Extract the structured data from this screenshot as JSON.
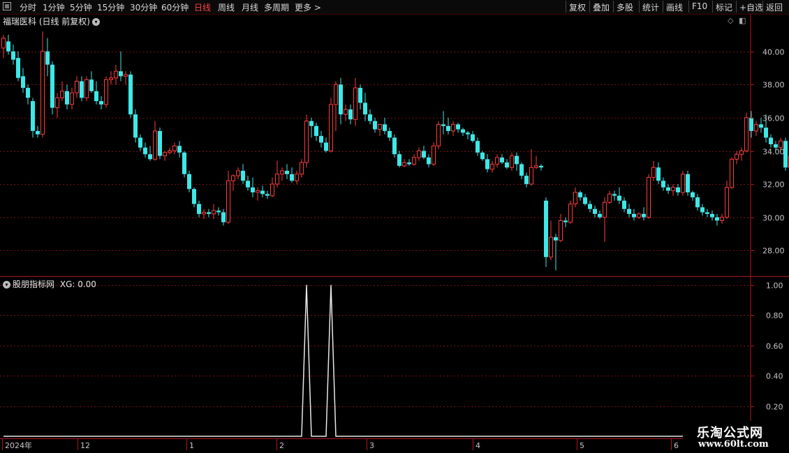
{
  "toolbar": {
    "periods": [
      {
        "label": "分时",
        "active": false
      },
      {
        "label": "1分钟",
        "active": false
      },
      {
        "label": "5分钟",
        "active": false
      },
      {
        "label": "15分钟",
        "active": false
      },
      {
        "label": "30分钟",
        "active": false
      },
      {
        "label": "60分钟",
        "active": false
      },
      {
        "label": "日线",
        "active": true
      },
      {
        "label": "周线",
        "active": false
      },
      {
        "label": "月线",
        "active": false
      },
      {
        "label": "多周期",
        "active": false
      },
      {
        "label": "更多 >",
        "active": false
      }
    ],
    "buttons": [
      "复权",
      "叠加",
      "多股",
      "统计",
      "画线",
      "F10",
      "标记",
      "+自选",
      "返回"
    ]
  },
  "main_pane": {
    "title": "福瑞医科 (日线 前复权)",
    "y_ticks": [
      "40.00",
      "38.00",
      "36.00",
      "34.00",
      "32.00",
      "30.00",
      "28.00"
    ]
  },
  "indicator_pane": {
    "title": "股朋指标网",
    "value_text": "XG: 0.00",
    "y_ticks": [
      "1.00",
      "0.80",
      "0.60",
      "0.40",
      "0.20"
    ]
  },
  "x_axis": {
    "labels": [
      "2024年",
      "12",
      "1",
      "2",
      "3",
      "4",
      "5",
      "6"
    ]
  },
  "watermark": {
    "title": "乐淘公式网",
    "url": "www.60lt.com"
  },
  "colors": {
    "up": "#ff3c3c",
    "down": "#3ee8e8",
    "grid": "#7a1010",
    "axis": "#b01818",
    "active_period": "#ff4040"
  },
  "chart_data": [
    {
      "type": "candlestick",
      "ylim": [
        26.5,
        41.5
      ],
      "ohlc": [
        [
          40.2,
          41.0,
          39.6,
          40.8
        ],
        [
          40.6,
          41.0,
          39.8,
          40.0
        ],
        [
          40.0,
          40.4,
          39.2,
          39.5
        ],
        [
          39.6,
          40.0,
          38.2,
          38.4
        ],
        [
          38.5,
          39.0,
          37.5,
          37.8
        ],
        [
          37.8,
          38.0,
          36.8,
          37.2
        ],
        [
          37.0,
          37.2,
          34.8,
          35.2
        ],
        [
          35.2,
          35.5,
          34.8,
          35.0
        ],
        [
          35.0,
          41.2,
          34.8,
          40.0
        ],
        [
          40.0,
          40.8,
          38.5,
          39.2
        ],
        [
          39.2,
          39.4,
          36.2,
          36.6
        ],
        [
          36.6,
          37.5,
          36.0,
          37.2
        ],
        [
          37.2,
          38.2,
          37.0,
          37.6
        ],
        [
          37.6,
          38.0,
          36.5,
          36.8
        ],
        [
          36.8,
          37.8,
          36.5,
          37.5
        ],
        [
          37.5,
          38.5,
          37.2,
          38.2
        ],
        [
          38.2,
          38.5,
          37.0,
          37.2
        ],
        [
          37.2,
          38.5,
          37.0,
          38.3
        ],
        [
          38.3,
          38.8,
          37.5,
          37.6
        ],
        [
          37.6,
          38.2,
          36.8,
          37.0
        ],
        [
          37.0,
          37.3,
          36.5,
          36.8
        ],
        [
          36.8,
          38.5,
          36.6,
          38.3
        ],
        [
          38.3,
          38.8,
          38.0,
          38.4
        ],
        [
          38.4,
          39.2,
          38.0,
          38.8
        ],
        [
          38.8,
          40.0,
          38.2,
          38.5
        ],
        [
          38.5,
          38.8,
          38.0,
          38.6
        ],
        [
          38.6,
          38.8,
          36.0,
          36.2
        ],
        [
          36.2,
          36.5,
          34.5,
          34.8
        ],
        [
          34.8,
          35.0,
          34.0,
          34.2
        ],
        [
          34.2,
          34.5,
          33.6,
          33.8
        ],
        [
          33.8,
          34.3,
          33.4,
          33.5
        ],
        [
          33.5,
          35.8,
          33.4,
          35.2
        ],
        [
          35.2,
          35.4,
          33.5,
          33.7
        ],
        [
          33.7,
          34.0,
          33.4,
          33.9
        ],
        [
          33.9,
          34.2,
          33.8,
          34.0
        ],
        [
          34.0,
          34.5,
          33.8,
          34.3
        ],
        [
          34.3,
          34.6,
          33.6,
          33.9
        ],
        [
          33.9,
          34.0,
          32.4,
          32.6
        ],
        [
          32.6,
          32.8,
          31.5,
          31.7
        ],
        [
          31.7,
          31.8,
          30.6,
          30.8
        ],
        [
          30.8,
          31.0,
          30.0,
          30.2
        ],
        [
          30.2,
          30.5,
          29.9,
          30.3
        ],
        [
          30.3,
          30.5,
          30.0,
          30.2
        ],
        [
          30.2,
          30.8,
          29.9,
          30.4
        ],
        [
          30.4,
          30.6,
          30.1,
          30.3
        ],
        [
          30.3,
          30.5,
          29.5,
          29.7
        ],
        [
          29.7,
          32.8,
          29.6,
          32.2
        ],
        [
          32.2,
          32.6,
          31.6,
          32.5
        ],
        [
          32.5,
          33.0,
          32.3,
          32.8
        ],
        [
          32.8,
          33.2,
          32.0,
          32.2
        ],
        [
          32.2,
          32.5,
          31.6,
          31.8
        ],
        [
          31.8,
          32.4,
          31.2,
          31.5
        ],
        [
          31.5,
          31.8,
          31.0,
          31.6
        ],
        [
          31.6,
          31.9,
          31.2,
          31.4
        ],
        [
          31.4,
          31.6,
          31.1,
          31.3
        ],
        [
          31.3,
          32.4,
          31.2,
          32.0
        ],
        [
          32.0,
          33.4,
          31.8,
          32.6
        ],
        [
          32.6,
          33.0,
          32.2,
          32.8
        ],
        [
          32.8,
          33.2,
          32.3,
          32.6
        ],
        [
          32.6,
          33.0,
          32.1,
          32.2
        ],
        [
          32.2,
          32.8,
          32.0,
          32.6
        ],
        [
          32.6,
          33.5,
          32.4,
          33.3
        ],
        [
          33.3,
          36.2,
          33.0,
          35.8
        ],
        [
          35.8,
          36.0,
          34.8,
          35.5
        ],
        [
          35.5,
          35.7,
          34.6,
          34.9
        ],
        [
          34.9,
          35.2,
          34.2,
          34.5
        ],
        [
          34.5,
          34.8,
          33.9,
          34.0
        ],
        [
          34.0,
          37.2,
          33.9,
          36.8
        ],
        [
          36.8,
          38.2,
          35.2,
          38.0
        ],
        [
          38.0,
          38.4,
          35.6,
          36.2
        ],
        [
          36.2,
          36.8,
          35.8,
          36.5
        ],
        [
          36.5,
          36.8,
          35.6,
          35.9
        ],
        [
          35.9,
          38.4,
          35.5,
          37.8
        ],
        [
          37.8,
          38.0,
          36.5,
          36.9
        ],
        [
          36.9,
          37.5,
          35.8,
          36.2
        ],
        [
          36.2,
          36.5,
          35.6,
          35.8
        ],
        [
          35.8,
          36.0,
          35.1,
          35.3
        ],
        [
          35.3,
          35.6,
          34.9,
          35.6
        ],
        [
          35.6,
          36.0,
          35.0,
          35.2
        ],
        [
          35.2,
          35.4,
          34.6,
          34.8
        ],
        [
          34.8,
          35.0,
          33.6,
          33.8
        ],
        [
          33.8,
          34.0,
          33.0,
          33.1
        ],
        [
          33.1,
          33.5,
          33.0,
          33.3
        ],
        [
          33.3,
          33.5,
          33.1,
          33.2
        ],
        [
          33.2,
          33.8,
          33.1,
          33.6
        ],
        [
          33.6,
          34.2,
          33.4,
          34.0
        ],
        [
          34.0,
          34.3,
          33.5,
          33.6
        ],
        [
          33.6,
          33.8,
          33.0,
          33.2
        ],
        [
          33.2,
          34.5,
          33.1,
          34.3
        ],
        [
          34.3,
          35.8,
          34.1,
          35.6
        ],
        [
          35.6,
          36.4,
          35.0,
          35.5
        ],
        [
          35.5,
          36.0,
          35.0,
          35.2
        ],
        [
          35.2,
          35.8,
          34.9,
          35.6
        ],
        [
          35.6,
          35.7,
          35.1,
          35.3
        ],
        [
          35.3,
          35.4,
          34.9,
          35.1
        ],
        [
          35.1,
          35.2,
          34.7,
          35.0
        ],
        [
          35.0,
          35.2,
          34.5,
          34.6
        ],
        [
          34.6,
          34.8,
          33.7,
          33.9
        ],
        [
          33.9,
          34.0,
          33.4,
          33.5
        ],
        [
          33.5,
          33.8,
          32.7,
          32.9
        ],
        [
          32.9,
          33.4,
          32.7,
          33.2
        ],
        [
          33.2,
          33.8,
          33.0,
          33.6
        ],
        [
          33.6,
          33.8,
          33.2,
          33.3
        ],
        [
          33.3,
          33.5,
          32.9,
          33.0
        ],
        [
          33.0,
          33.9,
          32.8,
          33.7
        ],
        [
          33.7,
          33.9,
          32.8,
          33.2
        ],
        [
          33.2,
          33.3,
          32.3,
          32.5
        ],
        [
          32.5,
          32.7,
          31.8,
          32.0
        ],
        [
          32.0,
          34.1,
          31.9,
          33.0
        ],
        [
          33.0,
          33.7,
          32.9,
          33.1
        ],
        [
          33.1,
          33.2,
          32.8,
          33.0
        ],
        [
          31.0,
          31.2,
          27.0,
          27.6
        ],
        [
          27.6,
          29.8,
          27.4,
          28.8
        ],
        [
          28.8,
          29.0,
          26.8,
          28.6
        ],
        [
          28.6,
          30.2,
          28.5,
          29.8
        ],
        [
          29.8,
          30.0,
          29.4,
          29.7
        ],
        [
          29.7,
          31.0,
          29.6,
          30.8
        ],
        [
          30.8,
          31.8,
          30.6,
          31.5
        ],
        [
          31.5,
          31.6,
          31.0,
          31.2
        ],
        [
          31.2,
          31.4,
          30.7,
          30.8
        ],
        [
          30.8,
          31.0,
          30.3,
          30.5
        ],
        [
          30.5,
          30.7,
          30.0,
          30.2
        ],
        [
          30.2,
          30.4,
          29.9,
          30.0
        ],
        [
          30.0,
          31.2,
          28.5,
          30.9
        ],
        [
          30.9,
          31.6,
          30.8,
          31.4
        ],
        [
          31.4,
          31.6,
          31.0,
          31.3
        ],
        [
          31.3,
          31.8,
          30.8,
          31.0
        ],
        [
          31.0,
          31.2,
          30.3,
          30.5
        ],
        [
          30.5,
          30.8,
          30.0,
          30.2
        ],
        [
          30.2,
          30.5,
          29.8,
          30.0
        ],
        [
          30.0,
          30.3,
          29.9,
          30.2
        ],
        [
          30.2,
          30.6,
          29.8,
          30.0
        ],
        [
          30.0,
          32.6,
          29.9,
          32.4
        ],
        [
          32.4,
          33.4,
          32.2,
          33.0
        ],
        [
          33.0,
          33.3,
          32.0,
          32.2
        ],
        [
          32.2,
          32.4,
          31.6,
          31.8
        ],
        [
          31.8,
          32.0,
          31.4,
          31.6
        ],
        [
          31.6,
          32.0,
          31.3,
          31.8
        ],
        [
          31.8,
          32.0,
          31.3,
          31.5
        ],
        [
          31.5,
          32.8,
          31.3,
          32.6
        ],
        [
          32.6,
          32.8,
          31.3,
          31.5
        ],
        [
          31.5,
          31.6,
          31.0,
          31.2
        ],
        [
          31.2,
          31.4,
          30.4,
          30.6
        ],
        [
          30.6,
          30.8,
          30.1,
          30.3
        ],
        [
          30.3,
          30.5,
          30.0,
          30.2
        ],
        [
          30.2,
          30.4,
          29.8,
          30.0
        ],
        [
          30.0,
          30.2,
          29.5,
          29.8
        ],
        [
          29.8,
          30.2,
          29.6,
          30.0
        ],
        [
          30.0,
          32.2,
          29.9,
          31.8
        ],
        [
          31.8,
          33.6,
          31.7,
          33.5
        ],
        [
          33.5,
          34.0,
          33.2,
          33.8
        ],
        [
          33.8,
          34.2,
          33.4,
          34.0
        ],
        [
          34.0,
          36.3,
          33.9,
          36.0
        ],
        [
          36.0,
          36.4,
          34.8,
          35.2
        ],
        [
          35.2,
          35.8,
          34.9,
          35.6
        ],
        [
          35.6,
          36.0,
          35.1,
          35.4
        ],
        [
          35.4,
          36.2,
          34.5,
          34.8
        ],
        [
          34.8,
          35.0,
          34.2,
          34.4
        ],
        [
          34.4,
          34.6,
          34.0,
          34.2
        ],
        [
          34.2,
          34.8,
          34.0,
          34.6
        ],
        [
          34.6,
          34.8,
          32.8,
          33.0
        ],
        [
          33.0,
          33.9,
          32.9,
          33.7
        ],
        [
          33.7,
          34.0,
          33.0,
          33.2
        ],
        [
          33.2,
          33.6,
          32.8,
          33.4
        ],
        [
          33.4,
          34.5,
          33.3,
          34.0
        ],
        [
          34.0,
          34.2,
          32.9,
          33.1
        ],
        [
          33.1,
          33.6,
          32.6,
          32.8
        ],
        [
          32.8,
          33.0,
          32.0,
          32.2
        ],
        [
          32.2,
          32.5,
          31.5,
          31.7
        ],
        [
          31.7,
          32.0,
          30.8,
          31.0
        ],
        [
          31.0,
          31.4,
          30.0,
          30.3
        ],
        [
          30.3,
          31.0,
          30.0,
          30.8
        ],
        [
          30.8,
          31.5,
          30.6,
          31.4
        ]
      ]
    },
    {
      "type": "line",
      "name": "XG",
      "ylim": [
        0,
        1.05
      ],
      "values": [
        0,
        0,
        0,
        0,
        0,
        0,
        0,
        0,
        0,
        0,
        0,
        0,
        0,
        0,
        0,
        0,
        0,
        0,
        0,
        0,
        0,
        0,
        0,
        0,
        0,
        0,
        0,
        0,
        0,
        0,
        0,
        0,
        0,
        0,
        0,
        0,
        0,
        0,
        0,
        0,
        0,
        0,
        0,
        0,
        0,
        0,
        0,
        0,
        0,
        0,
        0,
        0,
        0,
        0,
        0,
        0,
        0,
        0,
        0,
        0,
        0,
        0,
        1,
        0,
        0,
        0,
        0,
        1,
        0,
        0,
        0,
        0,
        0,
        0,
        0,
        0,
        0,
        0,
        0,
        0,
        0,
        0,
        0,
        0,
        0,
        0,
        0,
        0,
        0,
        0,
        0,
        0,
        0,
        0,
        0,
        0,
        0,
        0,
        0,
        0,
        0,
        0,
        0,
        0,
        0,
        0,
        0,
        0,
        0,
        0,
        0,
        0,
        0,
        0,
        0,
        0,
        0,
        0,
        0,
        0,
        0,
        0,
        0,
        0,
        0,
        0,
        0,
        0,
        0,
        0,
        0,
        0,
        0,
        0,
        0,
        0,
        0,
        0,
        0,
        0,
        0,
        0,
        0,
        0,
        0,
        0,
        0,
        0,
        0,
        0,
        0,
        0,
        0,
        0,
        0,
        0,
        0,
        0,
        0,
        0,
        0,
        0,
        0,
        0,
        0,
        0,
        0,
        0,
        0,
        0,
        0,
        0,
        0,
        0,
        0,
        0,
        0,
        0,
        0,
        0
      ]
    }
  ]
}
